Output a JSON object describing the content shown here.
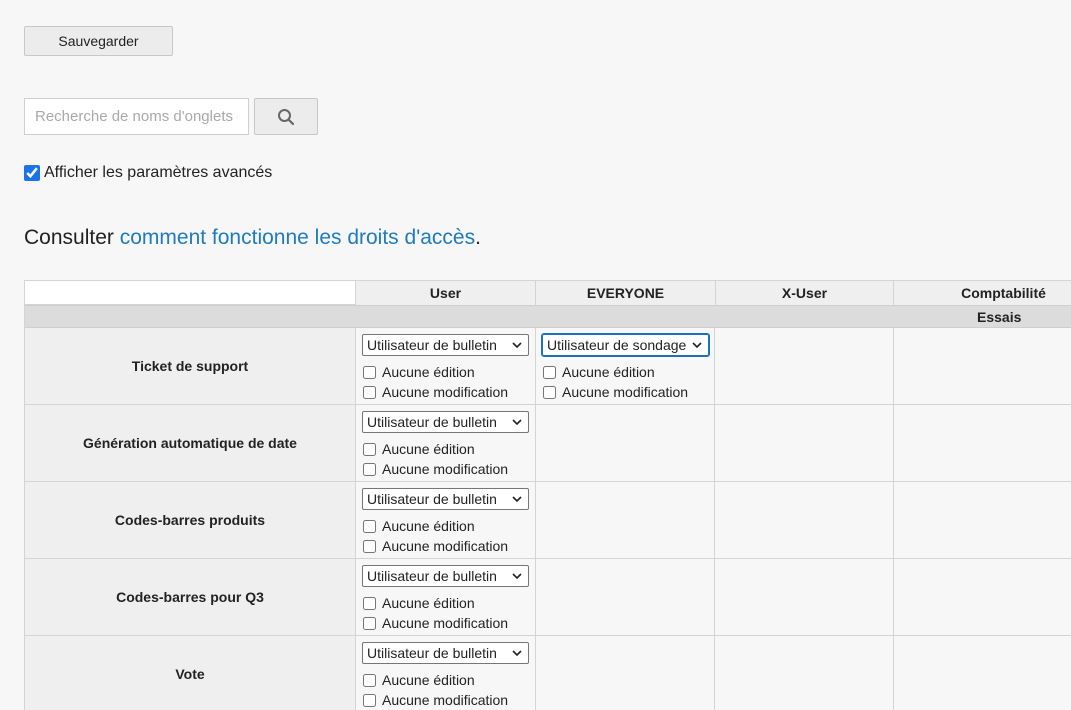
{
  "toolbar": {
    "save_label": "Sauvegarder"
  },
  "search": {
    "placeholder": "Recherche de noms d'onglets et"
  },
  "advanced": {
    "label": "Afficher les paramètres avancés",
    "checked": true
  },
  "consult": {
    "prefix": "Consulter ",
    "link": "comment fonctionne les droits d'accès",
    "suffix": "."
  },
  "table": {
    "columns": [
      "User",
      "EVERYONE",
      "X-User",
      "Comptabilité"
    ],
    "subheader": "Essais",
    "rows": [
      {
        "label": "Ticket de support",
        "user_select": "Utilisateur de bulletin",
        "everyone_select": "Utilisateur de sondage"
      },
      {
        "label": "Génération automatique de date",
        "user_select": "Utilisateur de bulletin"
      },
      {
        "label": "Codes-barres produits",
        "user_select": "Utilisateur de bulletin"
      },
      {
        "label": "Codes-barres pour Q3",
        "user_select": "Utilisateur de bulletin"
      },
      {
        "label": "Vote",
        "user_select": "Utilisateur de bulletin"
      }
    ],
    "opt_no_edit": "Aucune édition",
    "opt_no_modify": "Aucune modification"
  },
  "colors": {
    "link": "#1f7bc1",
    "header_bg": "#efefef",
    "subheader_bg": "#dcdcdc"
  }
}
